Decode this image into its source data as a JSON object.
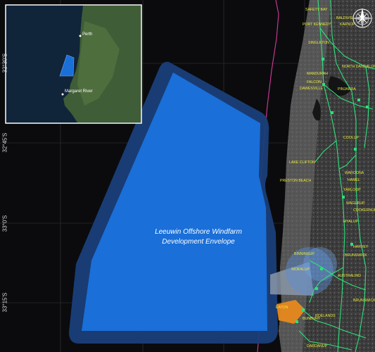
{
  "envelope": {
    "label_line1": "Leeuwin Offshore Windfarm",
    "label_line2": "Development Envelope",
    "fill_color": "#1a6fd8",
    "buffer_color": "#1a3f7a"
  },
  "latitude_labels": [
    "32°30'S",
    "32°45'S",
    "33°0'S",
    "33°15'S"
  ],
  "inset": {
    "labels": [
      "Perth",
      "Margaret River"
    ]
  },
  "towns": [
    "SAFETY BAY",
    "PORT KENNEDY",
    "BALDIVIS",
    "KARNUP",
    "SINGLETON",
    "MANDURAH",
    "NORTH DANDALUP",
    "FALCON",
    "PINJARRA",
    "DAWESVILLE",
    "COOLUP",
    "LAKE CLIFTON",
    "PRESTON BEACH",
    "WAROONA",
    "HAMEL",
    "YARLOOP",
    "WAGERUP",
    "COOKERNUP",
    "MYALUP",
    "HARVEY",
    "BINNINGUP",
    "WOKALUP",
    "BRUNSWICK",
    "AUSTRALIND",
    "BRUNSWICK JUNCTION",
    "EATON",
    "BUNBURY",
    "ROELANDS",
    "DARDANUP"
  ],
  "colors": {
    "background": "#0b0b0d",
    "transmission_lines": "#2ee07a",
    "state_waters_boundary": "#d23a9a",
    "town_labels": "#e8ea3a",
    "orange_area": "#e8891e"
  },
  "icons": [
    "compass-rose-icon"
  ]
}
